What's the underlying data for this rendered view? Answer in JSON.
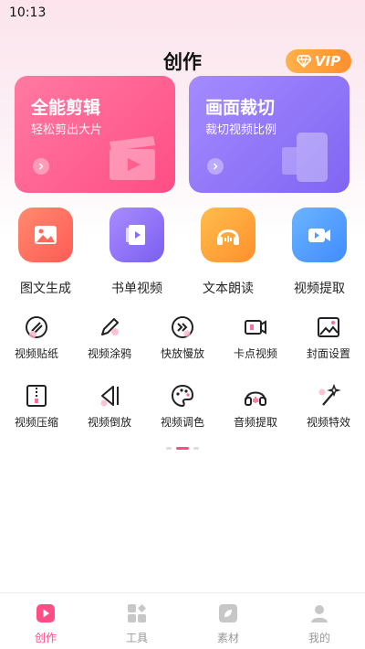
{
  "status_bar": {
    "time": "10:13"
  },
  "header": {
    "title": "创作",
    "vip_label": "VIP"
  },
  "feature_cards": [
    {
      "title": "全能剪辑",
      "subtitle": "轻松剪出大片"
    },
    {
      "title": "画面裁切",
      "subtitle": "裁切视频比例"
    }
  ],
  "big_tools": [
    {
      "label": "图文生成",
      "icon": "image-icon",
      "color": "#ff6a5c"
    },
    {
      "label": "书单视频",
      "icon": "book-video-icon",
      "color": "#8b6cf6"
    },
    {
      "label": "文本朗读",
      "icon": "headphones-icon",
      "color": "#ffa43a"
    },
    {
      "label": "视频提取",
      "icon": "video-camera-icon",
      "color": "#4a9cff"
    }
  ],
  "small_tools_row1": [
    {
      "label": "视频贴纸",
      "icon": "sticker-icon"
    },
    {
      "label": "视频涂鸦",
      "icon": "pen-icon"
    },
    {
      "label": "快放慢放",
      "icon": "fast-forward-icon"
    },
    {
      "label": "卡点视频",
      "icon": "video-clip-icon"
    },
    {
      "label": "封面设置",
      "icon": "cover-image-icon"
    }
  ],
  "small_tools_row2": [
    {
      "label": "视频压缩",
      "icon": "compress-icon"
    },
    {
      "label": "视频倒放",
      "icon": "reverse-icon"
    },
    {
      "label": "视频调色",
      "icon": "palette-icon"
    },
    {
      "label": "音频提取",
      "icon": "audio-headphones-icon"
    },
    {
      "label": "视频特效",
      "icon": "magic-wand-icon"
    }
  ],
  "pager": {
    "count": 3,
    "active": 1
  },
  "tab_bar": [
    {
      "label": "创作",
      "icon": "create-play-icon",
      "active": true
    },
    {
      "label": "工具",
      "icon": "tools-grid-icon",
      "active": false
    },
    {
      "label": "素材",
      "icon": "material-leaf-icon",
      "active": false
    },
    {
      "label": "我的",
      "icon": "profile-icon",
      "active": false
    }
  ],
  "accent_color": "#ff4d86"
}
